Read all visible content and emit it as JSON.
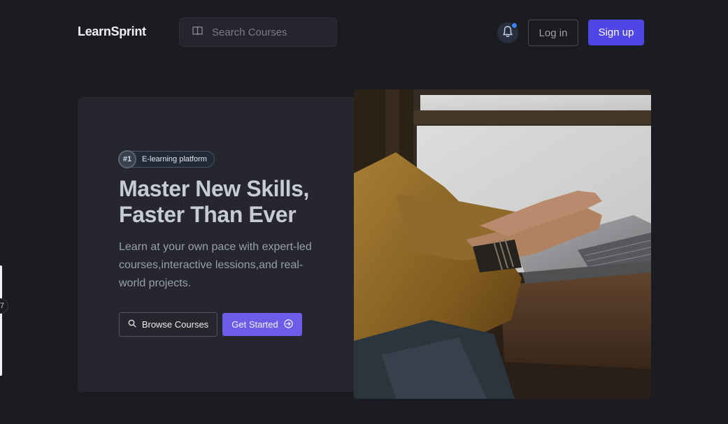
{
  "header": {
    "brand": "LearnSprint",
    "search": {
      "placeholder": "Search Courses",
      "value": ""
    },
    "notifications": {
      "icon": "bell-icon",
      "has_unread": true
    },
    "login_label": "Log in",
    "signup_label": "Sign up"
  },
  "hero": {
    "badge": {
      "number": "#1",
      "text": "E-learning platform"
    },
    "title_line1": "Master New Skills,",
    "title_line2": "Faster Than Ever",
    "description": "Learn at your own pace with expert-led courses,interactive lessions,and real-world projects.",
    "browse_label": "Browse Courses",
    "start_label": "Get Started",
    "image": "person-typing-on-laptop-photo"
  },
  "side_widget": {
    "handle_text": "7"
  },
  "colors": {
    "background": "#1b1b22",
    "card": "#26262f",
    "primary": "#4f46e5",
    "accent": "#6c5ce7",
    "notification_dot": "#3b82f6"
  }
}
